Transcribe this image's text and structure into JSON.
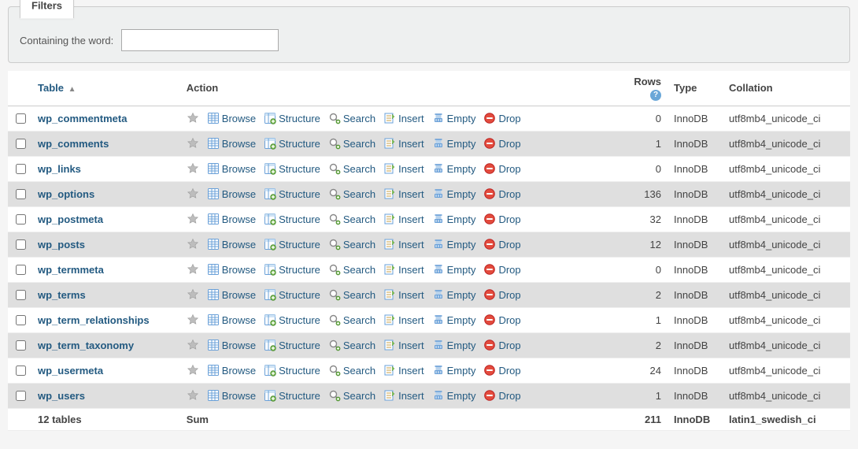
{
  "filters": {
    "tab_label": "Filters",
    "containing_label": "Containing the word:",
    "containing_value": ""
  },
  "columns": {
    "table": "Table",
    "action": "Action",
    "rows": "Rows",
    "type": "Type",
    "collation": "Collation"
  },
  "action_labels": {
    "browse": "Browse",
    "structure": "Structure",
    "search": "Search",
    "insert": "Insert",
    "empty": "Empty",
    "drop": "Drop"
  },
  "tables": [
    {
      "name": "wp_commentmeta",
      "rows": 0,
      "type": "InnoDB",
      "collation": "utf8mb4_unicode_ci"
    },
    {
      "name": "wp_comments",
      "rows": 1,
      "type": "InnoDB",
      "collation": "utf8mb4_unicode_ci"
    },
    {
      "name": "wp_links",
      "rows": 0,
      "type": "InnoDB",
      "collation": "utf8mb4_unicode_ci"
    },
    {
      "name": "wp_options",
      "rows": 136,
      "type": "InnoDB",
      "collation": "utf8mb4_unicode_ci"
    },
    {
      "name": "wp_postmeta",
      "rows": 32,
      "type": "InnoDB",
      "collation": "utf8mb4_unicode_ci"
    },
    {
      "name": "wp_posts",
      "rows": 12,
      "type": "InnoDB",
      "collation": "utf8mb4_unicode_ci"
    },
    {
      "name": "wp_termmeta",
      "rows": 0,
      "type": "InnoDB",
      "collation": "utf8mb4_unicode_ci"
    },
    {
      "name": "wp_terms",
      "rows": 2,
      "type": "InnoDB",
      "collation": "utf8mb4_unicode_ci"
    },
    {
      "name": "wp_term_relationships",
      "rows": 1,
      "type": "InnoDB",
      "collation": "utf8mb4_unicode_ci"
    },
    {
      "name": "wp_term_taxonomy",
      "rows": 2,
      "type": "InnoDB",
      "collation": "utf8mb4_unicode_ci"
    },
    {
      "name": "wp_usermeta",
      "rows": 24,
      "type": "InnoDB",
      "collation": "utf8mb4_unicode_ci"
    },
    {
      "name": "wp_users",
      "rows": 1,
      "type": "InnoDB",
      "collation": "utf8mb4_unicode_ci"
    }
  ],
  "footer": {
    "count_label": "12 tables",
    "sum_label": "Sum",
    "rows_sum": 211,
    "type": "InnoDB",
    "collation": "latin1_swedish_ci"
  }
}
